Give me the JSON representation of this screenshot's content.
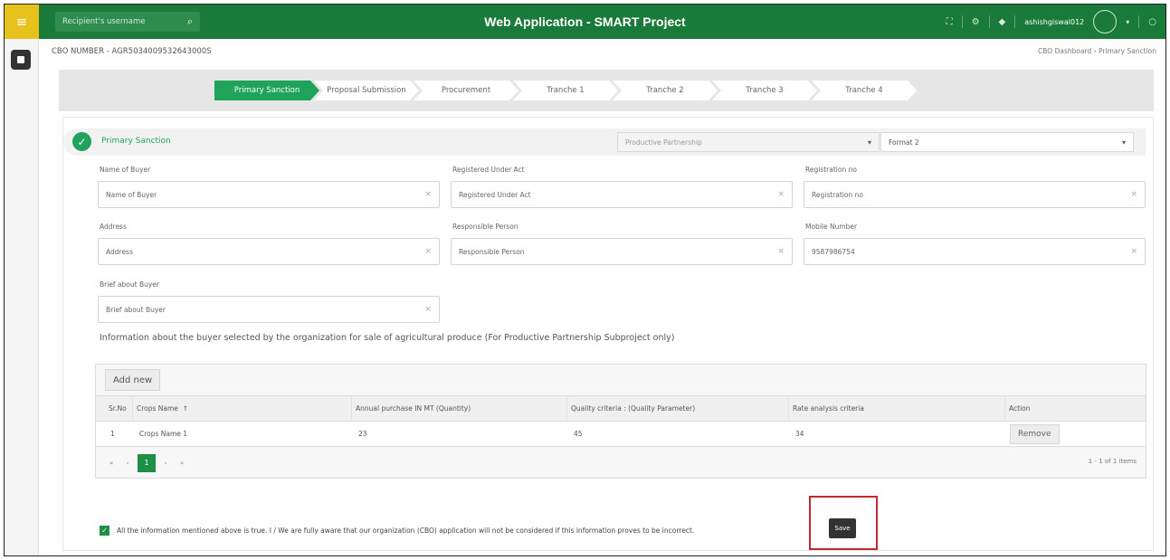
{
  "topbar": {
    "search_placeholder": "Recipient's username",
    "title": "Web Application - SMART Project",
    "user": "ashishgiswal012"
  },
  "page": {
    "cbo_number": "CBO NUMBER - AGR5034009532643000S",
    "breadcrumb": "CBO Dashboard  ›  Primary Sanction"
  },
  "stepper": [
    {
      "label": "Primary Sanction",
      "active": true
    },
    {
      "label": "Proposal Submission",
      "active": false
    },
    {
      "label": "Procurement",
      "active": false
    },
    {
      "label": "Tranche 1",
      "active": false
    },
    {
      "label": "Tranche 2",
      "active": false
    },
    {
      "label": "Tranche 3",
      "active": false
    },
    {
      "label": "Tranche 4",
      "active": false
    }
  ],
  "section": {
    "title": "Primary Sanction",
    "select1": "Productive Partnership",
    "select2": "Format 2"
  },
  "form": {
    "name_of_buyer": {
      "label": "Name of Buyer",
      "value": "Name of Buyer"
    },
    "registered_under_act": {
      "label": "Registered Under Act",
      "value": "Registered Under Act"
    },
    "registration_no": {
      "label": "Registration no",
      "value": "Registration no"
    },
    "address": {
      "label": "Address",
      "value": "Address"
    },
    "responsible_person": {
      "label": "Responsible Person",
      "value": "Responsible Person"
    },
    "mobile_number": {
      "label": "Mobile Number",
      "value": "9587986754"
    },
    "brief_about_buyer": {
      "label": "Brief about Buyer",
      "value": "Brief about Buyer"
    }
  },
  "info_text": "Information about the buyer selected by the organization for sale of agricultural produce (For Productive Partnership Subproject only)",
  "grid": {
    "add_label": "Add new",
    "columns": [
      "Sr.No",
      "Crops Name",
      "Annual purchase IN MT (Quantity)",
      "Quality criteria : (Quality Parameter)",
      "Rate analysis criteria",
      "Action"
    ],
    "rows": [
      {
        "srno": "1",
        "crop": "Crops Name 1",
        "annual": "23",
        "quality": "45",
        "rate": "34",
        "action": "Remove"
      }
    ],
    "pages": [
      "«",
      "‹",
      "1",
      "›",
      "»"
    ],
    "pager_info": "1 - 1 of 1 items"
  },
  "confirm_text": "All the information mentioned above is true. I / We are fully aware that our organization (CBO) application will not be considered if this information proves to be incorrect.",
  "save_label": "Save",
  "colors": {
    "brand_green": "#1a7a3a",
    "accent_green": "#1fa35a",
    "menu_yellow": "#e8c21c",
    "highlight_red": "#c8272d"
  }
}
